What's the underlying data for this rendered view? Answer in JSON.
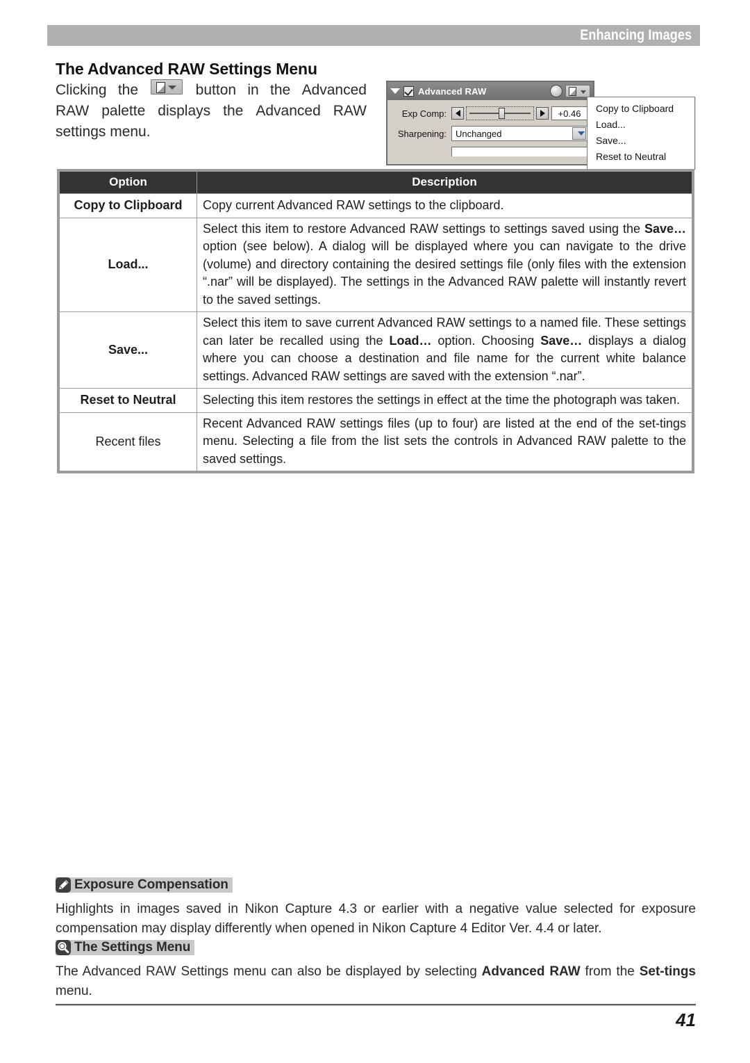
{
  "header": {
    "running_head": "Enhancing Images"
  },
  "section": {
    "title": "The Advanced RAW Settings Menu",
    "intro_line1_a": "Clicking",
    "intro_line1_b": "the",
    "intro_line1_icon": "document-dropdown-button-icon",
    "intro_line1_c": "button",
    "intro_line1_d": "in",
    "intro_line1_e": "the",
    "intro_line1_f": "Advanced",
    "intro_line2_a": "RAW",
    "intro_line2_b": "palette",
    "intro_line2_c": "displays",
    "intro_line2_d": "the",
    "intro_line2_e": "Advanced",
    "intro_line2_f": "RAW",
    "intro_line3": "settings menu."
  },
  "figure": {
    "palette_title": "Advanced RAW",
    "exp_comp_label": "Exp Comp:",
    "exp_comp_value": "+0.46",
    "sharpening_label": "Sharpening:",
    "sharpening_value": "Unchanged",
    "menu_items": [
      "Copy to Clipboard",
      "Load...",
      "Save...",
      "Reset to Neutral"
    ]
  },
  "table": {
    "headers": [
      "Option",
      "Description"
    ],
    "rows": [
      {
        "option": "Copy to Clipboard",
        "option_bold": true,
        "description_html": "Copy current Advanced RAW settings to the clipboard."
      },
      {
        "option": "Load...",
        "option_bold": true,
        "description_html": "Select this item to restore Advanced RAW settings to settings saved using the <b>Save…</b> option (see below).  A dialog will be displayed where you can navigate to the drive (volume) and directory containing the desired settings file (only files with the extension “.nar” will be displayed).  The settings in the Advanced RAW palette will instantly revert to the saved settings."
      },
      {
        "option": "Save...",
        "option_bold": true,
        "description_html": "Select this item to save current Advanced RAW settings to a named file.  These settings can later be recalled using the <b>Load…</b> option.  Choosing <b>Save…</b> displays a dialog where you can choose a destination and file name for the current white balance settings.  Advanced RAW settings are saved with the extension “.nar”."
      },
      {
        "option": "Reset to Neutral",
        "option_bold": true,
        "description_html": "Selecting this item restores the settings in effect at the time the photograph was taken."
      },
      {
        "option": "Recent files",
        "option_bold": false,
        "description_html": "Recent Advanced RAW settings files (up to four) are listed at the end of the set-tings menu.  Selecting a file from the list sets the controls in Advanced RAW palette to the saved settings."
      }
    ]
  },
  "notes": [
    {
      "icon": "pencil-icon",
      "title": "Exposure Compensation",
      "body_html": "Highlights in images saved in Nikon Capture 4.3 or earlier with a negative value selected for exposure compensation may display differently when opened in Nikon Capture 4 Editor Ver. 4.4 or later."
    },
    {
      "icon": "magnifier-icon",
      "title": "The Settings Menu",
      "body_html": "The Advanced RAW Settings menu can also be displayed by selecting <b>Advanced RAW</b> from the <b>Set-tings</b> menu."
    }
  ],
  "footer": {
    "page_number": "41"
  },
  "colors": {
    "banner_gray": "#b0b0b0",
    "table_header_dark": "#333333",
    "table_border_gray": "#9b9b9b",
    "note_highlight": "#c9c9c9"
  }
}
